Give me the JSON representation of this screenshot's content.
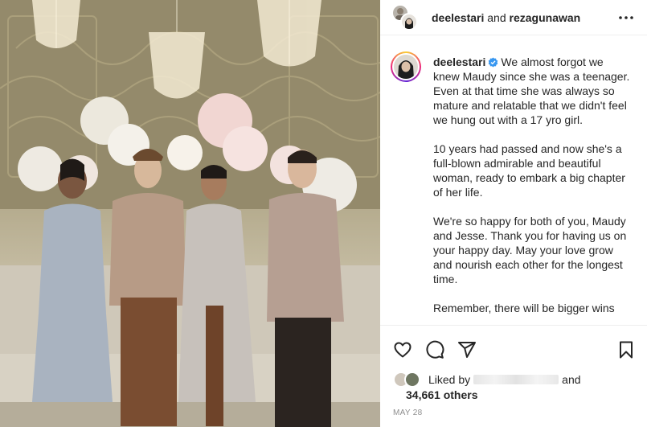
{
  "header": {
    "user1": "deelestari",
    "connector": "and",
    "user2": "rezagunawan"
  },
  "caption": {
    "username": "deelestari",
    "text": "We almost forgot we knew Maudy since she was a teenager. Even at that time she was always so mature and relatable that we didn't feel we hung out with a 17 yro girl.\n\n10 years had passed and now she's a full-blown admirable and beautiful woman, ready to embark a big chapter of her life.\n\nWe're so happy for both of you, Maudy and Jesse. Thank you for having us on your happy day. May your love grow and nourish each other for the longest time.\n\nRemember, there will be bigger wins"
  },
  "likes": {
    "prefix": "Liked by",
    "suffix": "and",
    "count_text": "34,661 others"
  },
  "date": "MAY 28",
  "icons": {
    "more": "more-options-icon",
    "verified": "verified-badge-icon",
    "like": "heart-icon",
    "comment": "comment-icon",
    "share": "share-icon",
    "save": "bookmark-icon"
  },
  "colors": {
    "verified": "#3897f0",
    "text": "#262626",
    "secondary": "#8e8e8e"
  }
}
